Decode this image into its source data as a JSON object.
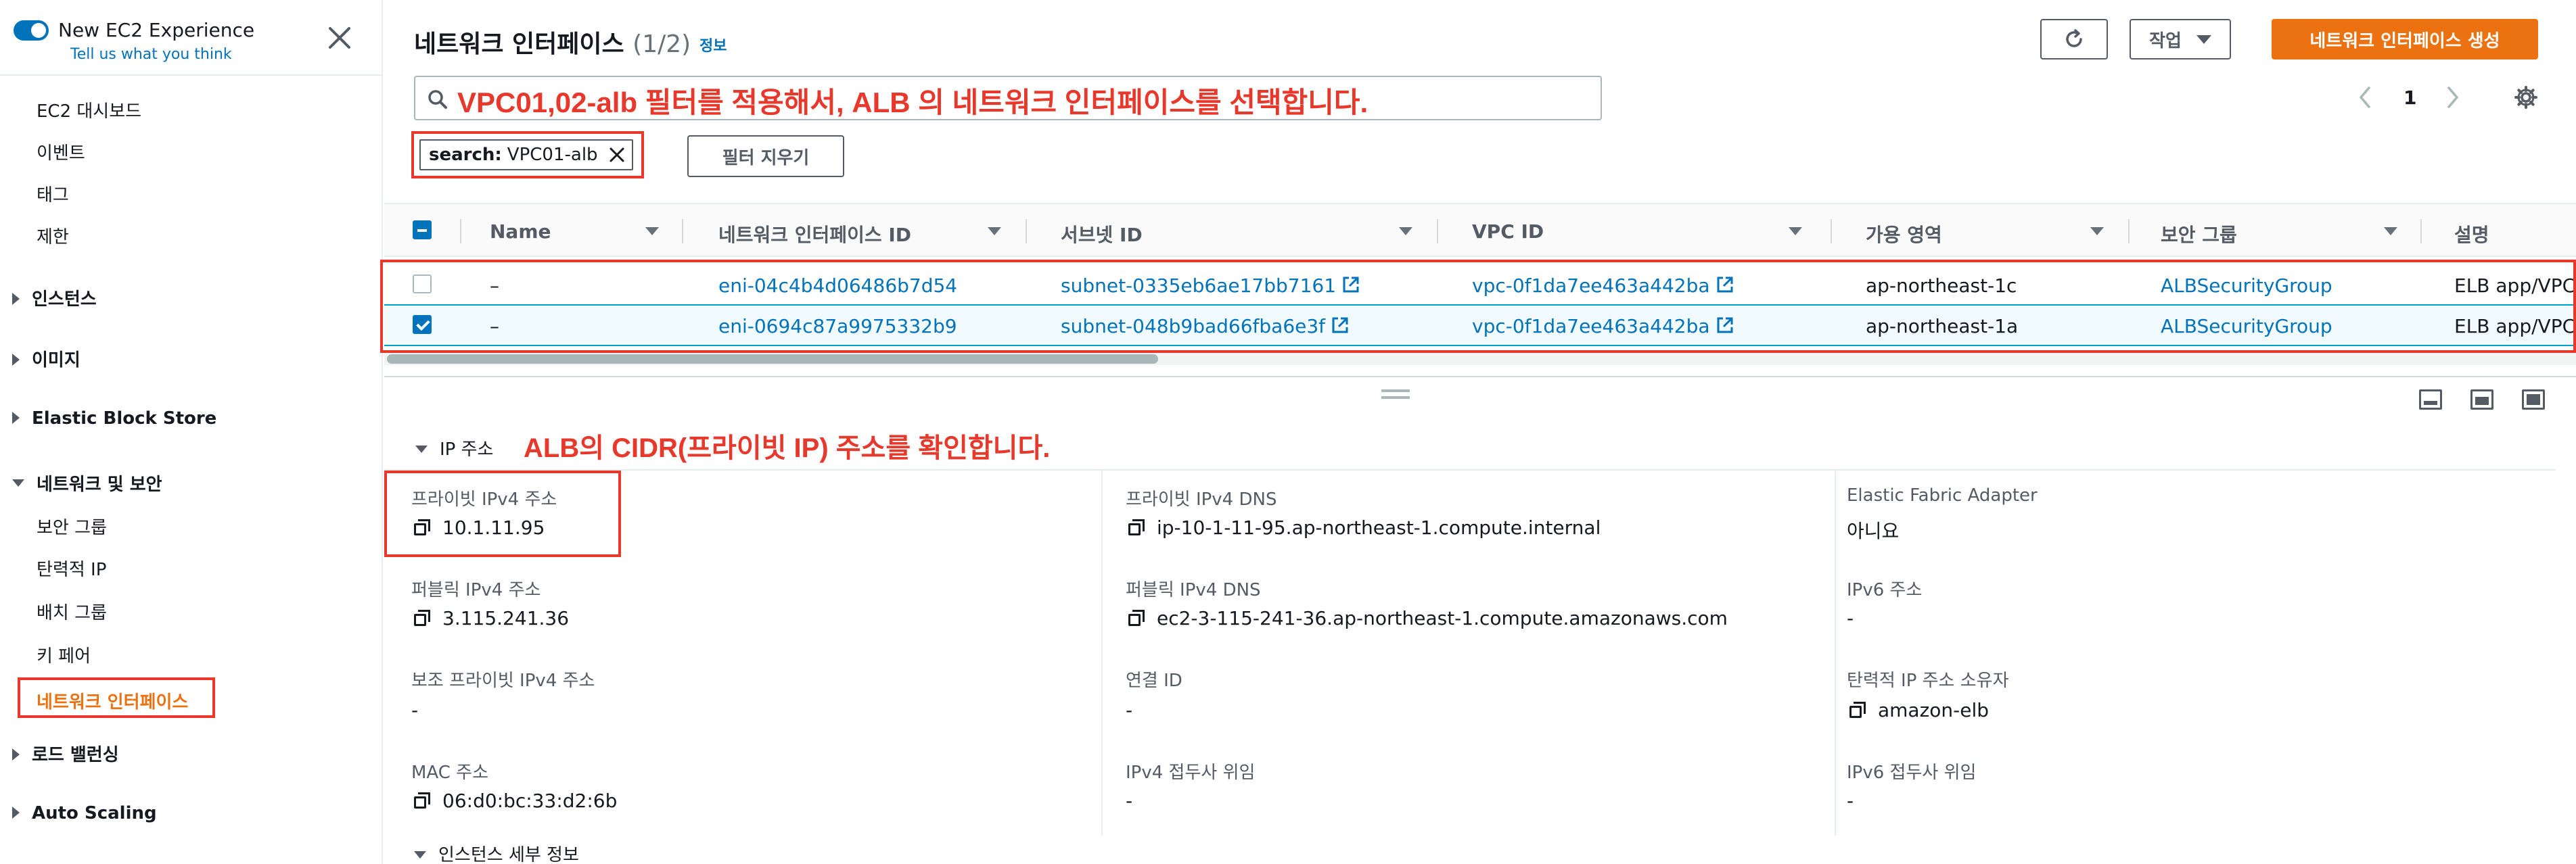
{
  "sidebar": {
    "new_experience_title": "New EC2 Experience",
    "new_experience_link": "Tell us what you think",
    "items_top": [
      "EC2 대시보드",
      "이벤트",
      "태그",
      "제한"
    ],
    "cat_instances": "인스턴스",
    "cat_images": "이미지",
    "cat_ebs": "Elastic Block Store",
    "cat_network": "네트워크 및 보안",
    "network_items": [
      "보안 그룹",
      "탄력적 IP",
      "배치 그룹",
      "키 페어"
    ],
    "active_item": "네트워크 인터페이스",
    "cat_lb": "로드 밸런싱",
    "cat_autoscaling": "Auto Scaling"
  },
  "header": {
    "title": "네트워크 인터페이스",
    "count": "(1/2)",
    "info": "정보",
    "actions_label": "작업",
    "create_label": "네트워크 인터페이스 생성"
  },
  "search": {
    "annotation": "VPC01,02-alb 필터를 적용해서, ALB 의 네트워크 인터페이스를 선택합니다.",
    "token_key": "search:",
    "token_value": "VPC01-alb",
    "clear_label": "필터 지우기"
  },
  "pagination": {
    "current_page": "1"
  },
  "table": {
    "columns": [
      "Name",
      "네트워크 인터페이스 ID",
      "서브넷 ID",
      "VPC ID",
      "가용 영역",
      "보안 그룹",
      "설명"
    ],
    "rows": [
      {
        "selected": false,
        "name": "–",
        "eni": "eni-04c4b4d06486b7d54",
        "subnet": "subnet-0335eb6ae17bb7161",
        "vpc": "vpc-0f1da7ee463a442ba",
        "az": "ap-northeast-1c",
        "sg": "ALBSecurityGroup",
        "desc": "ELB app/VPC"
      },
      {
        "selected": true,
        "name": "–",
        "eni": "eni-0694c87a9975332b9",
        "subnet": "subnet-048b9bad66fba6e3f",
        "vpc": "vpc-0f1da7ee463a442ba",
        "az": "ap-northeast-1a",
        "sg": "ALBSecurityGroup",
        "desc": "ELB app/VPC"
      }
    ]
  },
  "details": {
    "section_ip": "IP 주소",
    "annotation": "ALB의 CIDR(프라이빗 IP) 주소를 확인합니다.",
    "fields": {
      "private_ipv4_label": "프라이빗 IPv4 주소",
      "private_ipv4": "10.1.11.95",
      "public_ipv4_label": "퍼블릭 IPv4 주소",
      "public_ipv4": "3.115.241.36",
      "secondary_private_label": "보조 프라이빗 IPv4 주소",
      "secondary_private": "-",
      "mac_label": "MAC 주소",
      "mac": "06:d0:bc:33:d2:6b",
      "private_dns_label": "프라이빗 IPv4 DNS",
      "private_dns": "ip-10-1-11-95.ap-northeast-1.compute.internal",
      "public_dns_label": "퍼블릭 IPv4 DNS",
      "public_dns": "ec2-3-115-241-36.ap-northeast-1.compute.amazonaws.com",
      "attach_id_label": "연결 ID",
      "attach_id": "-",
      "ipv4_delegation_label": "IPv4 접두사 위임",
      "ipv4_delegation": "-",
      "efa_label": "Elastic Fabric Adapter",
      "efa": "아니요",
      "ipv6_label": "IPv6 주소",
      "ipv6": "-",
      "eip_owner_label": "탄력적 IP 주소 소유자",
      "eip_owner": "amazon-elb",
      "ipv6_delegation_label": "IPv6 접두사 위임",
      "ipv6_delegation": "-"
    },
    "section_instance": "인스턴스 세부 정보"
  },
  "colors": {
    "accent": "#ec7211",
    "link": "#0073bb",
    "annotation": "#e8382b",
    "selected_bg": "#f1faff"
  },
  "icons": [
    "close-icon",
    "search-icon",
    "refresh-icon",
    "chevron-left-icon",
    "chevron-right-icon",
    "gear-icon",
    "external-link-icon",
    "copy-icon"
  ]
}
